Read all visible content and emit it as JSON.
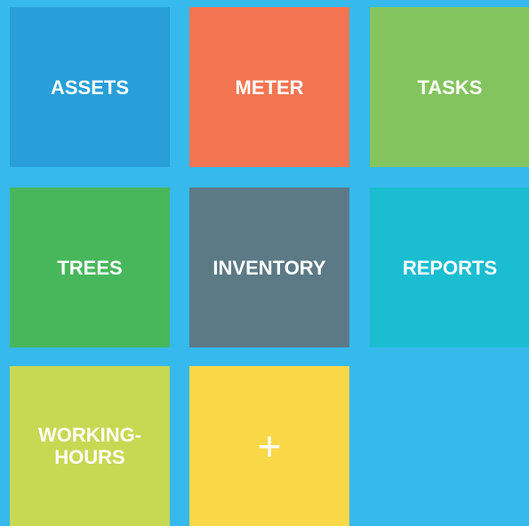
{
  "tiles": [
    {
      "label": "ASSETS",
      "color": "#289fd9"
    },
    {
      "label": "METER",
      "color": "#f47552"
    },
    {
      "label": "TASKS",
      "color": "#84c45e"
    },
    {
      "label": "TREES",
      "color": "#48b75c"
    },
    {
      "label": "INVENTORY",
      "color": "#5c7a85"
    },
    {
      "label": "REPORTS",
      "color": "#1bbdd1"
    },
    {
      "label": "WORKING-\nHOURS",
      "color": "#c6d953"
    },
    {
      "label": "+",
      "color": "#f9d848",
      "icon": "plus-icon"
    }
  ],
  "background_color": "#36b9ec"
}
